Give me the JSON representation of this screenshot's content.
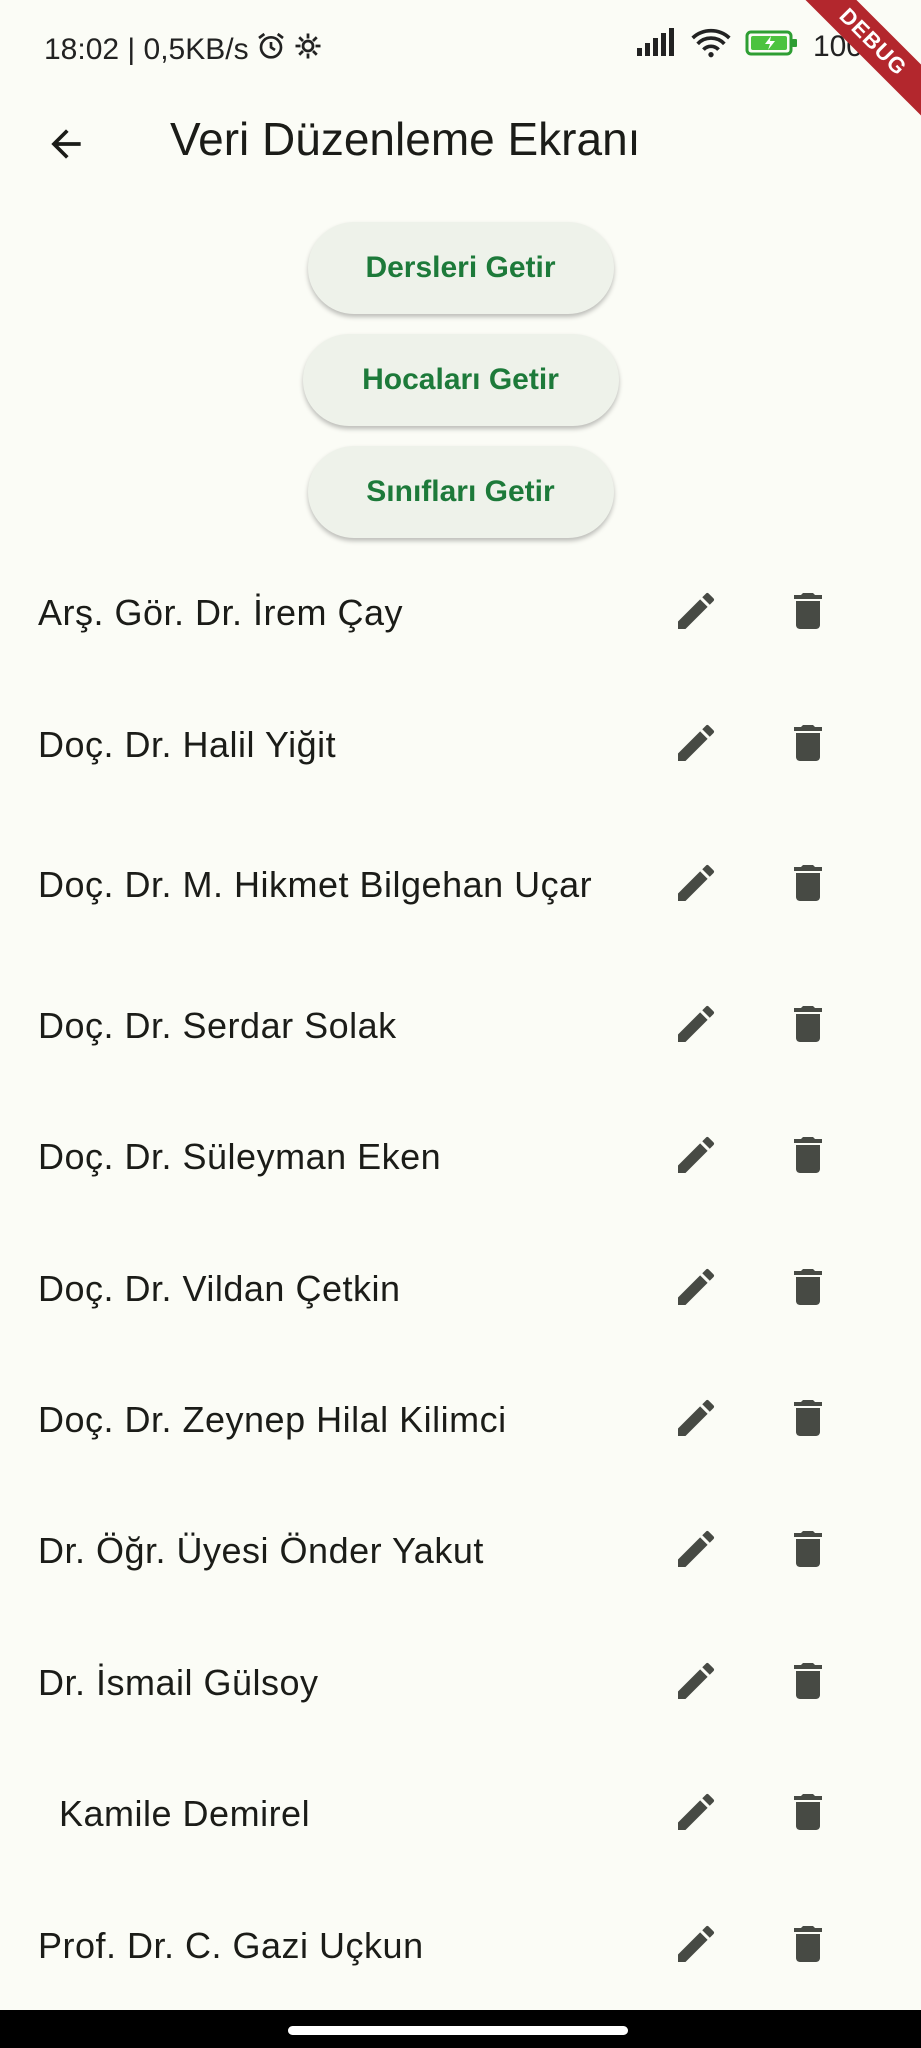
{
  "status": {
    "time_speed": "18:02 | 0,5KB/s",
    "battery": "100",
    "debug_label": "DEBUG"
  },
  "appbar": {
    "title": "Veri Düzenleme Ekranı"
  },
  "buttons": {
    "courses": "Dersleri Getir",
    "teachers": "Hocaları Getir",
    "classes": "Sınıfları Getir"
  },
  "list": [
    "Arş. Gör. Dr. İrem Çay",
    "Doç. Dr. Halil Yiğit",
    "Doç. Dr. M. Hikmet Bilgehan Uçar",
    "Doç. Dr. Serdar Solak",
    "Doç. Dr. Süleyman Eken",
    "Doç. Dr. Vildan Çetkin",
    "Doç. Dr. Zeynep Hilal Kilimci",
    "Dr. Öğr. Üyesi Önder Yakut",
    "Dr. İsmail Gülsoy",
    "  Kamile Demirel",
    "Prof. Dr. C. Gazi Uçkun"
  ],
  "colors": {
    "accent": "#1d7a3a",
    "icon": "#474a44",
    "background": "#fbfcf6"
  }
}
